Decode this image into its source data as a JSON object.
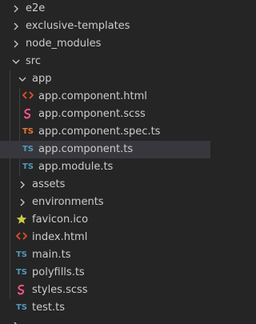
{
  "explorer": {
    "items": [
      {
        "label": "e2e",
        "kind": "folder",
        "expanded": false
      },
      {
        "label": "exclusive-templates",
        "kind": "folder",
        "expanded": false
      },
      {
        "label": "node_modules",
        "kind": "folder",
        "expanded": false
      },
      {
        "label": "src",
        "kind": "folder",
        "expanded": true
      },
      {
        "label": "app",
        "kind": "folder",
        "expanded": true
      },
      {
        "label": "app.component.html",
        "kind": "html",
        "icon_glyph": "<>"
      },
      {
        "label": "app.component.scss",
        "kind": "scss"
      },
      {
        "label": "app.component.spec.ts",
        "kind": "spec-ts",
        "icon_glyph": "TS"
      },
      {
        "label": "app.component.ts",
        "kind": "ts",
        "icon_glyph": "TS",
        "selected": true
      },
      {
        "label": "app.module.ts",
        "kind": "ts",
        "icon_glyph": "TS"
      },
      {
        "label": "assets",
        "kind": "folder",
        "expanded": false
      },
      {
        "label": "environments",
        "kind": "folder",
        "expanded": false
      },
      {
        "label": "favicon.ico",
        "kind": "favicon"
      },
      {
        "label": "index.html",
        "kind": "html",
        "icon_glyph": "<>"
      },
      {
        "label": "main.ts",
        "kind": "ts",
        "icon_glyph": "TS"
      },
      {
        "label": "polyfills.ts",
        "kind": "ts",
        "icon_glyph": "TS"
      },
      {
        "label": "styles.scss",
        "kind": "scss"
      },
      {
        "label": "test.ts",
        "kind": "ts",
        "icon_glyph": "TS"
      }
    ]
  },
  "colors": {
    "background": "#252526",
    "selected_row": "#37373d",
    "text": "#cccccc",
    "ts": "#519aba",
    "spec_ts": "#e37933",
    "html": "#e44d26",
    "scss": "#f55385",
    "favicon": "#cbcb41",
    "chevron": "#c5c5c5"
  }
}
